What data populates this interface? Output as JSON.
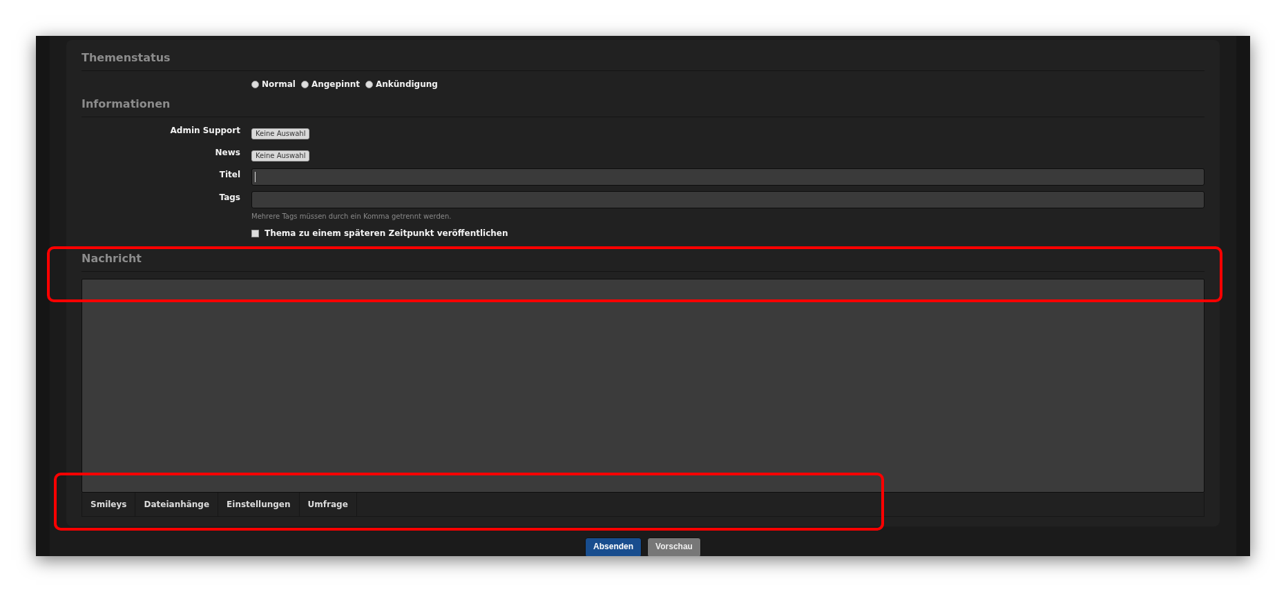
{
  "topic_status": {
    "heading": "Themenstatus",
    "options": [
      {
        "label": "Normal",
        "selected": false
      },
      {
        "label": "Angepinnt",
        "selected": false
      },
      {
        "label": "Ankündigung",
        "selected": false
      }
    ]
  },
  "information": {
    "heading": "Informationen",
    "fields": [
      {
        "kind": "dropdown",
        "label": "Admin Support",
        "value": "Keine Auswahl"
      },
      {
        "kind": "dropdown",
        "label": "News",
        "value": "Keine Auswahl"
      },
      {
        "kind": "text",
        "label": "Titel",
        "focused": true
      },
      {
        "kind": "text",
        "label": "Tags",
        "hint": "Mehrere Tags müssen durch ein Komma getrennt werden."
      }
    ],
    "schedule": {
      "label": "Thema zu einem späteren Zeitpunkt veröffentlichen",
      "checked": false
    }
  },
  "message": {
    "heading": "Nachricht",
    "tabs": [
      {
        "label": "Smileys",
        "selected": false
      },
      {
        "label": "Dateianhänge",
        "selected": false
      },
      {
        "label": "Einstellungen",
        "selected": false
      },
      {
        "label": "Umfrage",
        "selected": false
      }
    ]
  },
  "buttons": [
    {
      "label": "Absenden",
      "kind": "primary"
    },
    {
      "label": "Vorschau",
      "kind": "secondary"
    }
  ]
}
